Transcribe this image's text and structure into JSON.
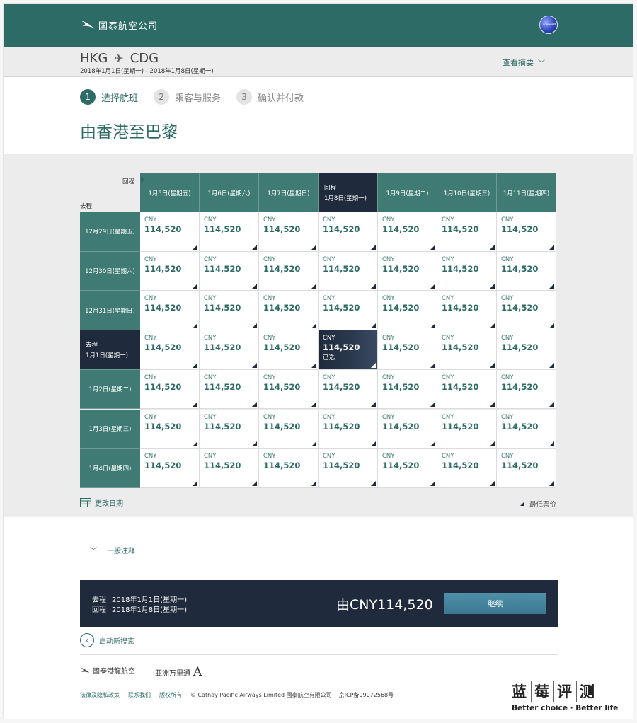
{
  "header": {
    "logo_text": "國泰航空公司",
    "alliance_badge": "oneworld"
  },
  "route": {
    "origin": "HKG",
    "destination": "CDG",
    "dates": "2018年1月1日(星期一) - 2018年1月8日(星期一)",
    "summary_link": "查看摘要"
  },
  "steps": [
    {
      "num": "1",
      "label": "选择航班",
      "active": true
    },
    {
      "num": "2",
      "label": "乘客与服务",
      "active": false
    },
    {
      "num": "3",
      "label": "确认并付款",
      "active": false
    }
  ],
  "page_title": "由香港至巴黎",
  "matrix": {
    "return_label": "回程",
    "outbound_label": "去程",
    "selected_tag_return": "回程",
    "selected_tag_outbound": "去程",
    "selected_note": "已选",
    "return_dates": [
      "1月5日(星期五)",
      "1月6日(星期六)",
      "1月7日(星期日)",
      "1月8日(星期一)",
      "1月9日(星期二)",
      "1月10日(星期三)",
      "1月11日(星期四)"
    ],
    "outbound_dates": [
      "12月29日(星期五)",
      "12月30日(星期六)",
      "12月31日(星期日)",
      "1月1日(星期一)",
      "1月2日(星期二)",
      "1月3日(星期三)",
      "1月4日(星期四)"
    ],
    "selected_row": 3,
    "selected_col": 3,
    "currency": "CNY",
    "prices": [
      [
        "114,520",
        "114,520",
        "114,520",
        "114,520",
        "114,520",
        "114,520",
        "114,520"
      ],
      [
        "114,520",
        "114,520",
        "114,520",
        "114,520",
        "114,520",
        "114,520",
        "114,520"
      ],
      [
        "114,520",
        "114,520",
        "114,520",
        "114,520",
        "114,520",
        "114,520",
        "114,520"
      ],
      [
        "114,520",
        "114,520",
        "114,520",
        "114,520",
        "114,520",
        "114,520",
        "114,520"
      ],
      [
        "114,520",
        "114,520",
        "114,520",
        "114,520",
        "114,520",
        "114,520",
        "114,520"
      ],
      [
        "114,520",
        "114,520",
        "114,520",
        "114,520",
        "114,520",
        "114,520",
        "114,520"
      ],
      [
        "114,520",
        "114,520",
        "114,520",
        "114,520",
        "114,520",
        "114,520",
        "114,520"
      ]
    ],
    "change_date_label": "更改日期",
    "lowest_fare_label": "最低票价"
  },
  "notes": {
    "general_notes": "一般注释"
  },
  "summary": {
    "outbound_label": "去程",
    "outbound_date": "2018年1月1日(星期一)",
    "return_label": "回程",
    "return_date": "2018年1月8日(星期一)",
    "total": "由CNY114,520",
    "continue": "继续"
  },
  "new_search": "启动新搜索",
  "footer": {
    "dragon_logo": "國泰港龍航空",
    "asia_miles": "亚洲万里通",
    "links": [
      "法律及隐私政策",
      "联系我们",
      "版权所有"
    ],
    "copyright": "© Cathay Pacific Airways Limited 國泰航空有限公司",
    "icp": "京ICP备09072568号"
  },
  "watermark": {
    "chars": [
      "蓝",
      "莓",
      "评",
      "测"
    ],
    "tagline": "Better choice · Better life"
  },
  "colors": {
    "brand_teal": "#2d6b66",
    "header_cell": "#3f7b74",
    "selected_navy": "#1f2b3c"
  }
}
